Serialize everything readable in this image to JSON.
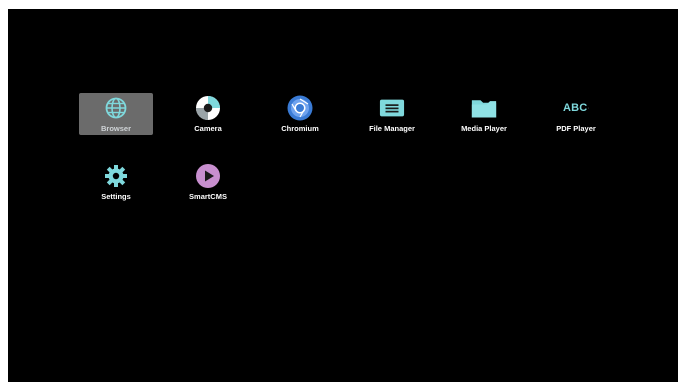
{
  "launcher": {
    "accent_color": "#7fd8dc",
    "selected_app": "Browser",
    "apps": [
      {
        "label": "Browser",
        "icon": "globe-icon"
      },
      {
        "label": "Camera",
        "icon": "camera-icon"
      },
      {
        "label": "Chromium",
        "icon": "chromium-icon"
      },
      {
        "label": "File Manager",
        "icon": "file-manager-icon"
      },
      {
        "label": "Media Player",
        "icon": "folder-icon"
      },
      {
        "label": "PDF Player",
        "icon": "abc-icon",
        "icon_text": "ABC"
      },
      {
        "label": "Settings",
        "icon": "gear-icon"
      },
      {
        "label": "SmartCMS",
        "icon": "play-icon"
      }
    ]
  }
}
